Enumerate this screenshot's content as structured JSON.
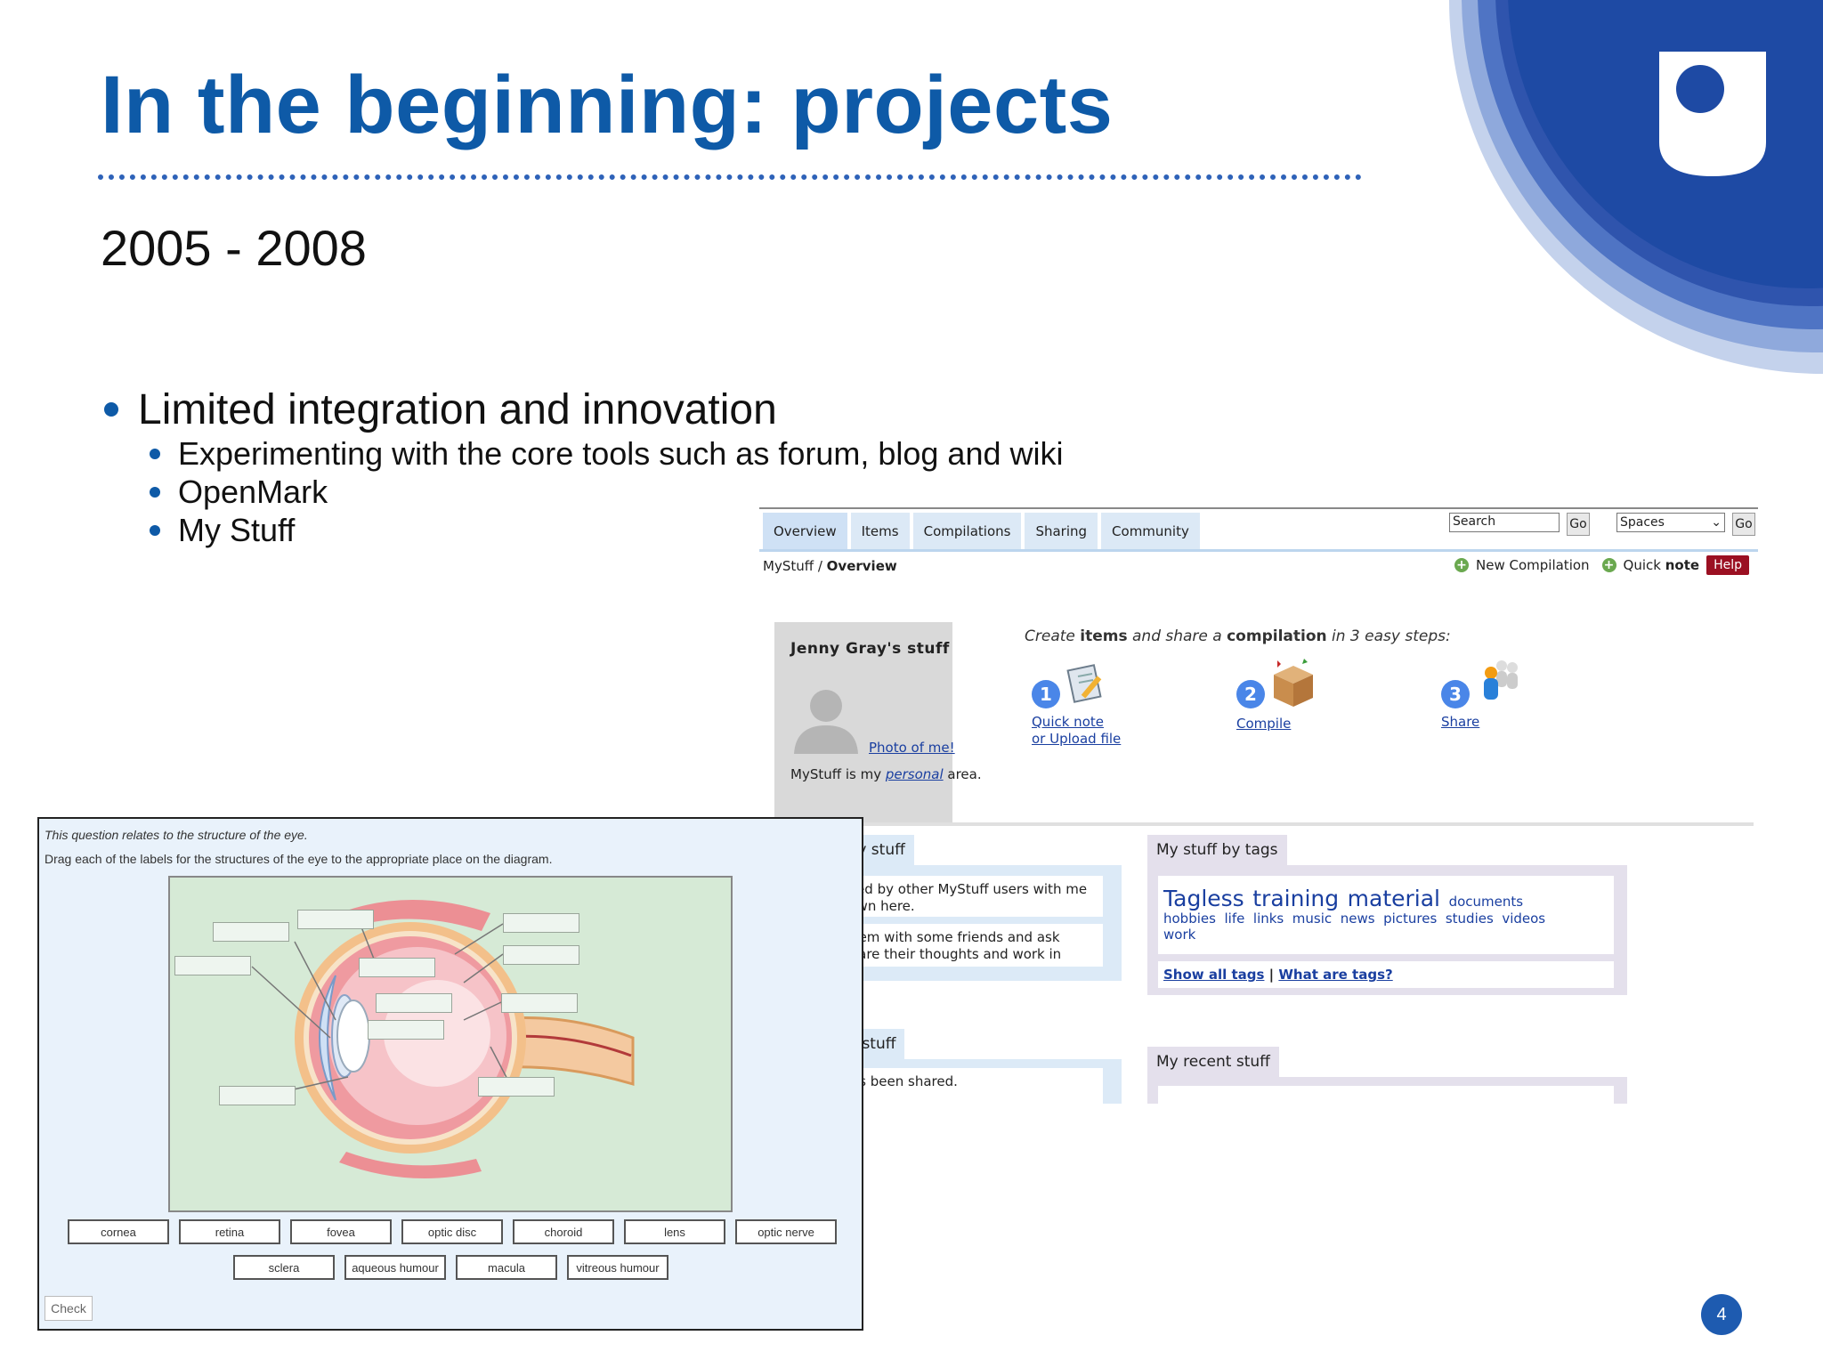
{
  "slide": {
    "title": "In the beginning: projects",
    "subtitle": "2005 - 2008",
    "bullet_main": "Limited integration and innovation",
    "sub_bullets": [
      "Experimenting with the core tools such as forum, blog and wiki",
      "OpenMark",
      "My Stuff"
    ],
    "page_number": "4",
    "colors": {
      "title_blue": "#0e5aa7",
      "logo_blue": "#1e4fa8"
    }
  },
  "openmark": {
    "question_intro": "This question relates to the structure of the eye.",
    "instruction": "Drag each of the labels for the structures of the eye to the appropriate place on the diagram.",
    "labels_row1": [
      "cornea",
      "retina",
      "fovea",
      "optic disc",
      "choroid",
      "lens",
      "optic nerve"
    ],
    "labels_row2": [
      "sclera",
      "aqueous humour",
      "macula",
      "vitreous humour"
    ],
    "check_label": "Check"
  },
  "mystuff": {
    "tabs": [
      "Overview",
      "Items",
      "Compilations",
      "Sharing",
      "Community"
    ],
    "search_value": "Search",
    "go_label": "Go",
    "spaces_value": "Spaces",
    "breadcrumb_root": "MyStuff",
    "breadcrumb_sep": " / ",
    "breadcrumb_current": "Overview",
    "new_compilation": "New Compilation",
    "quick": "Quick",
    "note": "note",
    "help": "Help",
    "profile_name": "Jenny Gray's  stuff",
    "photo_link": "Photo of me!",
    "profile_note_pre": "MyStuff is my ",
    "profile_note_link": "personal",
    "profile_note_post": " area.",
    "steps_t1": "Create ",
    "steps_t2": "items",
    "steps_t3": " and share a ",
    "steps_t4": "compilation",
    "steps_t5": " in 3 easy steps:",
    "steps": [
      {
        "num": "1",
        "line1": "Quick note",
        "line2": "or Upload file"
      },
      {
        "num": "2",
        "line1": "Compile",
        "line2": ""
      },
      {
        "num": "3",
        "line1": "Share",
        "line2": ""
      }
    ],
    "community_head": "Community stuff",
    "community_text1": "Items shared by other MyStuff users with me will be shown here.",
    "community_text2": "Share an item with some friends and ask them to share their thoughts and work in return.",
    "shared_head": "My shared stuff",
    "shared_text": "No stuff has been shared.",
    "tags_head": "My stuff by tags",
    "tags_big": [
      "Tagless",
      "training",
      "material"
    ],
    "tags_small": [
      "documents",
      "hobbies",
      "life",
      "links",
      "music",
      "news",
      "pictures",
      "studies",
      "videos",
      "work"
    ],
    "show_all_tags": "Show all tags",
    "tag_sep": " | ",
    "what_are_tags": "What are tags?",
    "recent_head": "My recent stuff"
  }
}
